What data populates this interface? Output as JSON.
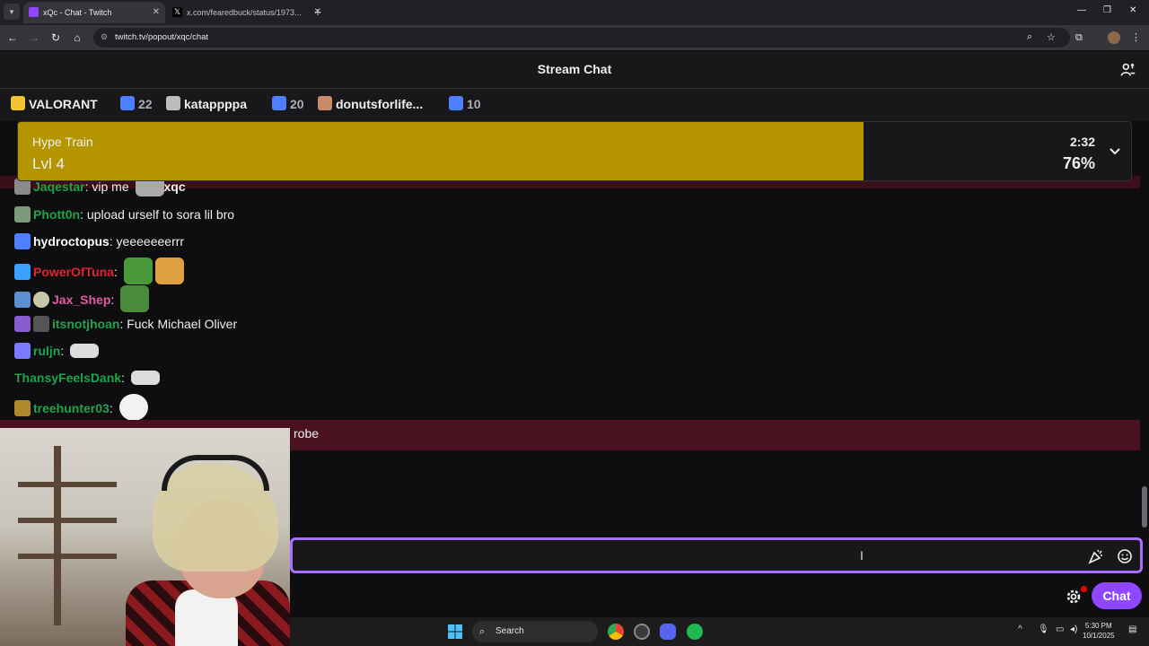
{
  "browser": {
    "tabs": [
      {
        "title": "xQc - Chat - Twitch",
        "active": true
      },
      {
        "title": "x.com/fearedbuck/status/1973...",
        "active": false
      }
    ],
    "url": "twitch.tv/popout/xqc/chat"
  },
  "chat": {
    "title": "Stream Chat",
    "input_placeholder": "",
    "send_label": "Chat"
  },
  "leaderboard": [
    {
      "label": "VALORANT",
      "kind": "name",
      "color": "#f0c430"
    },
    {
      "label": "22",
      "kind": "count"
    },
    {
      "label": "katappppa",
      "kind": "name",
      "color": "#bdbdbd"
    },
    {
      "label": "20",
      "kind": "count"
    },
    {
      "label": "donutsforlife...",
      "kind": "name",
      "color": "#c98a6a"
    },
    {
      "label": "10",
      "kind": "count"
    }
  ],
  "hype_train": {
    "title": "Hype Train",
    "level": "Lvl 4",
    "time": "2:32",
    "percent_text": "76%",
    "progress": 0.76,
    "fill_color": "#b49500"
  },
  "messages": [
    {
      "user": "Jaqestar",
      "color": "#1fa34a",
      "text": ": vip me",
      "extra": "xqc",
      "badge": "#8a8a8a"
    },
    {
      "user": "Phott0n",
      "color": "#1fa34a",
      "text": ": upload urself to sora lil bro",
      "badge": "#7a9a7a"
    },
    {
      "user": "hydroctopus",
      "color": "#ffffff",
      "text": ": yeeeeeeerrr",
      "badge": "#4d7fff"
    },
    {
      "user": "PowerOfTuna",
      "color": "#e0232e",
      "text": ":",
      "badge": "#3aa0ff",
      "emotes": 2
    },
    {
      "user": "Jax_Shep",
      "color": "#e05aa0",
      "text": ":",
      "badge": "#5a8fd0",
      "emotes": 1
    },
    {
      "user": "itsnotjhoan",
      "color": "#1fa34a",
      "text": ": Fuck Michael Oliver",
      "badge": "#8a5ad0"
    },
    {
      "user": "ruljn",
      "color": "#1fa34a",
      "text": ":",
      "badge": "#7a7aff",
      "emotes": 1
    },
    {
      "user": "ThansyFeelsDank",
      "color": "#1fa34a",
      "text": ":",
      "emotes": 1
    },
    {
      "user": "treehunter03",
      "color": "#1fa34a",
      "text": ":",
      "badge": "#b08a2a",
      "emotes": 1
    },
    {
      "user": "",
      "color": "#efeff1",
      "text": "robe",
      "highlight": true
    }
  ],
  "taskbar": {
    "search_label": "Search",
    "time": "5:30 PM",
    "date": "10/1/2025"
  }
}
